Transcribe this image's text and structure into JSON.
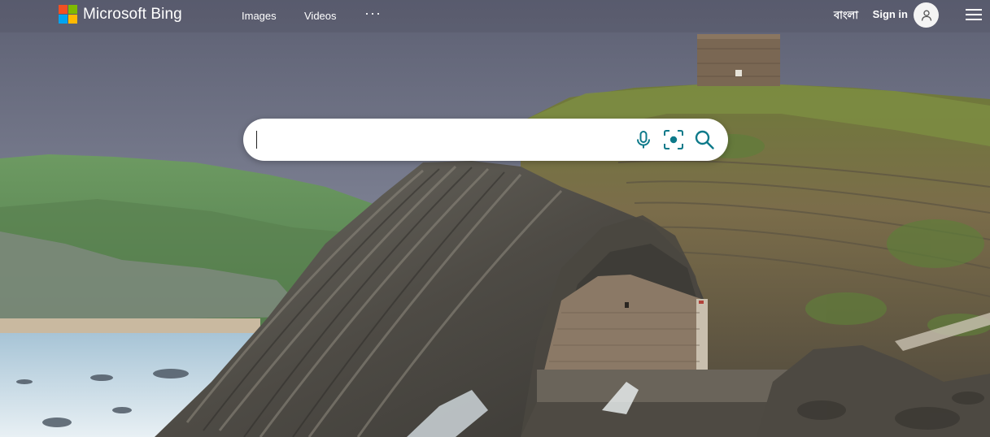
{
  "header": {
    "logo_text": "Microsoft Bing",
    "nav": {
      "images": "Images",
      "videos": "Videos",
      "more": "···"
    },
    "language": "বাংলা",
    "sign_in": "Sign in"
  },
  "search": {
    "value": "",
    "placeholder": "",
    "mic_label": "Search using voice",
    "visual_label": "Search using an image",
    "submit_label": "Search"
  },
  "icons": {
    "logo": "microsoft-logo-icon",
    "avatar": "user-avatar-icon",
    "menu": "hamburger-menu-icon",
    "mic": "microphone-icon",
    "visual": "visual-search-icon",
    "search": "search-icon"
  },
  "colors": {
    "accent": "#0e7a8a",
    "ms_red": "#f25022",
    "ms_green": "#7fba00",
    "ms_blue": "#00a4ef",
    "ms_yellow": "#ffb900"
  }
}
